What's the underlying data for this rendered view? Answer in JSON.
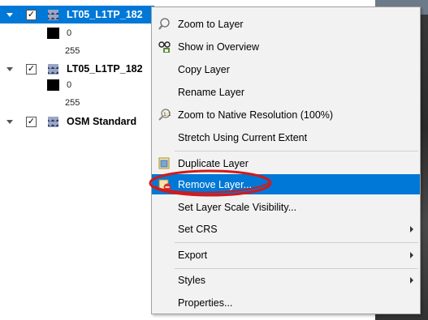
{
  "layers": [
    {
      "name": "LT05_L1TP_182",
      "checked": "✓",
      "selected": true,
      "legend": {
        "min": "0",
        "max": "255"
      }
    },
    {
      "name": "LT05_L1TP_182",
      "checked": "✓",
      "selected": false,
      "legend": {
        "min": "0",
        "max": "255"
      }
    },
    {
      "name": "OSM Standard",
      "checked": "✓",
      "selected": false
    }
  ],
  "context_menu": {
    "items": [
      {
        "label": "Zoom to Layer",
        "icon": "zoom-layer-icon"
      },
      {
        "label": "Show in Overview",
        "icon": "overview-icon"
      },
      {
        "label": "Copy Layer"
      },
      {
        "label": "Rename Layer"
      },
      {
        "label": "Zoom to Native Resolution (100%)",
        "icon": "native-resolution-icon"
      },
      {
        "label": "Stretch Using Current Extent"
      },
      {
        "label": "Duplicate Layer",
        "icon": "duplicate-layer-icon"
      },
      {
        "label": "Remove Layer...",
        "icon": "remove-layer-icon",
        "highlighted": true
      },
      {
        "label": "Set Layer Scale Visibility..."
      },
      {
        "label": "Set CRS",
        "submenu": true
      },
      {
        "label": "Export",
        "submenu": true
      },
      {
        "label": "Styles",
        "submenu": true
      },
      {
        "label": "Properties..."
      }
    ]
  },
  "colors": {
    "selection": "#0078d7",
    "annotation": "#d11a1a"
  }
}
